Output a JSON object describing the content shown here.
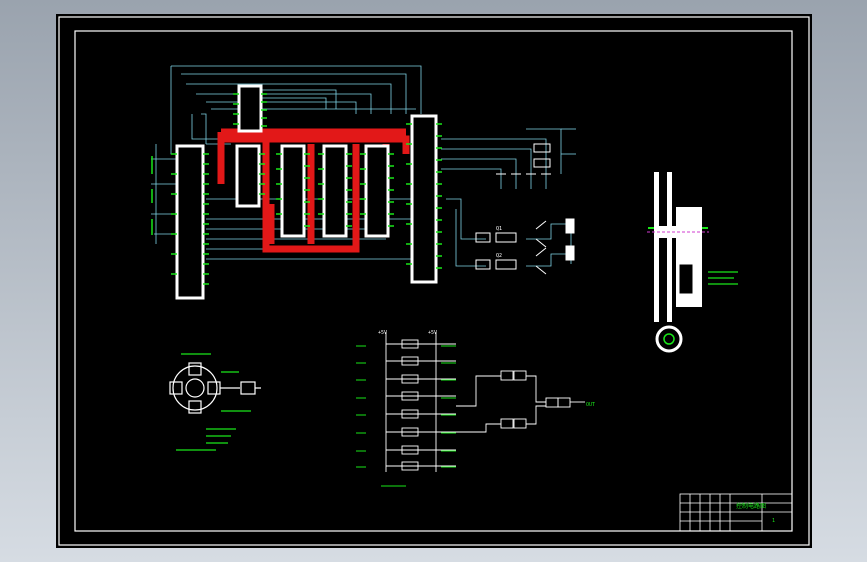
{
  "colors": {
    "background": "#000000",
    "frame": "#ffffff",
    "wire": "#7fd3e6",
    "bus": "#e21818",
    "label": "#19e619",
    "chip": "#ffffff",
    "magenta": "#d23cd2"
  },
  "circuit": {
    "voltage_a": "+5V",
    "voltage_b": "+5V",
    "opto_label": "Q1",
    "driver_label": "Q2",
    "output_label": "OUT"
  },
  "title_block": {
    "title": "控制电路图",
    "sheet_no": "1"
  }
}
